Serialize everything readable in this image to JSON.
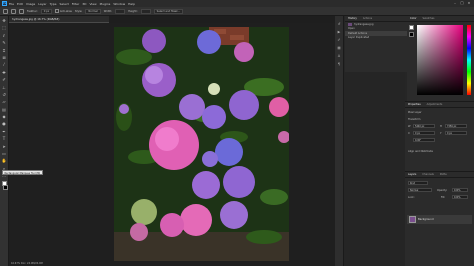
{
  "menubar": {
    "logo": "Ps",
    "items": [
      "File",
      "Edit",
      "Image",
      "Layer",
      "Type",
      "Select",
      "Filter",
      "3D",
      "View",
      "Plugins",
      "Window",
      "Help"
    ],
    "minimize": "–",
    "maximize": "□",
    "close": "×"
  },
  "options": {
    "style_label": "Style:",
    "style_value": "Normal",
    "width_label": "Width:",
    "height_label": "Height:",
    "select_mask": "Select and Mask...",
    "feather_label": "Feather:",
    "feather_value": "0 px",
    "anti_alias": "Anti-alias"
  },
  "document": {
    "tab_title": "hydrangeas.jpg @ 16.7% (RGB/8#)",
    "status": "16.67%  Doc: 24.0M/24.0M"
  },
  "tooltip": "Rectangular Marquee Tool (M)",
  "history_panel": {
    "tabs": [
      "History",
      "Actions"
    ],
    "rows": [
      "hydrangeas.jpg",
      "Open",
      "Default Actions",
      "Layer Duplicated"
    ]
  },
  "color_panel": {
    "tabs": [
      "Color",
      "Swatches"
    ],
    "accent": "#e6007e"
  },
  "properties_panel": {
    "tabs": [
      "Properties",
      "Adjustments"
    ],
    "section": "Pixel Layer",
    "transform_label": "Transform",
    "w_label": "W",
    "w_value": "5440 px",
    "h_label": "H",
    "h_value": "7256 px",
    "x_label": "X",
    "x_value": "0 px",
    "y_label": "Y",
    "y_value": "0 px",
    "angle": "0.00°",
    "align_label": "Align and Distribute"
  },
  "layers_panel": {
    "tabs": [
      "Layers",
      "Channels",
      "Paths"
    ],
    "kind_label": "Kind",
    "blend_mode": "Normal",
    "opacity_label": "Opacity:",
    "opacity": "100%",
    "lock_label": "Lock:",
    "fill_label": "Fill:",
    "fill": "100%",
    "layer_name": "Background"
  },
  "colors": {
    "accent": "#31a8ff",
    "chrome_dark": "#1e1e1e",
    "panel": "#2b2b2b"
  }
}
